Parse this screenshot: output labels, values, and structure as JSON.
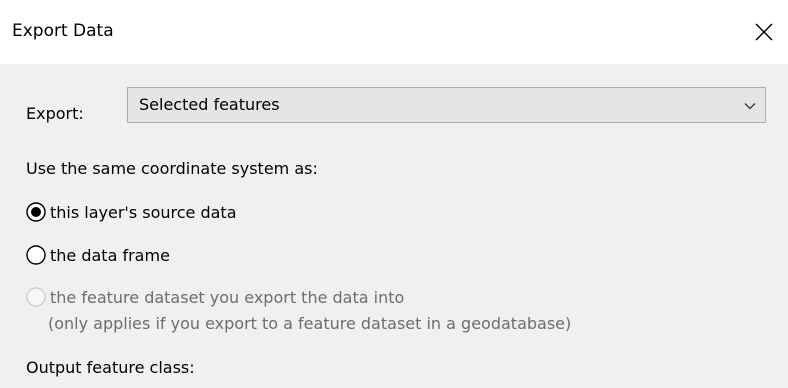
{
  "window": {
    "title": "Export Data",
    "close_icon": "close-icon"
  },
  "export": {
    "label": "Export:",
    "selected": "Selected features",
    "chevron_icon": "chevron-down-icon"
  },
  "coordinate_system": {
    "label": "Use the same coordinate system as:",
    "options": [
      {
        "label": "this layer's source data",
        "selected": true,
        "enabled": true
      },
      {
        "label": "the data frame",
        "selected": false,
        "enabled": true
      },
      {
        "label": "the feature dataset you export the data into",
        "selected": false,
        "enabled": false
      }
    ],
    "option3_note": "(only applies if you export to a feature dataset in a geodatabase)"
  },
  "output": {
    "label": "Output feature class:"
  },
  "colors": {
    "content_bg": "#f0f0f0",
    "select_bg": "#e5e5e5",
    "select_border": "#adadad",
    "disabled_text": "#6d6d6d"
  }
}
